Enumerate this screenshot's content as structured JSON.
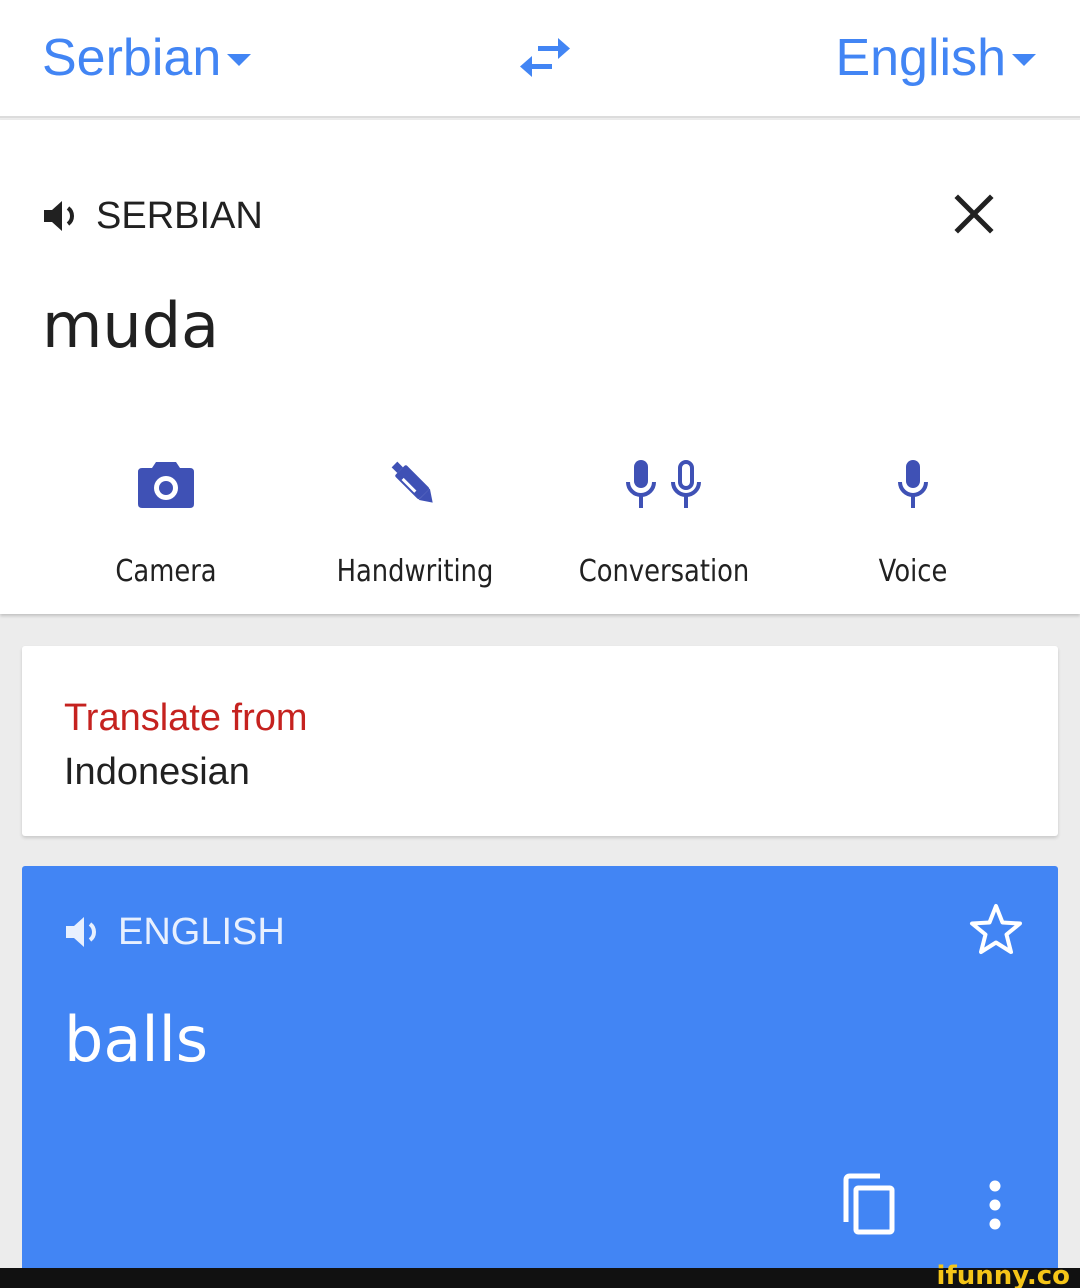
{
  "header": {
    "source_language": "Serbian",
    "target_language": "English",
    "swap_icon": "swap-arrows-icon",
    "accent_color": "#4285f4"
  },
  "input": {
    "language_label": "SERBIAN",
    "text": "muda",
    "tools": [
      {
        "label": "Camera",
        "icon": "camera-icon"
      },
      {
        "label": "Handwriting",
        "icon": "pen-icon"
      },
      {
        "label": "Conversation",
        "icon": "double-mic-icon"
      },
      {
        "label": "Voice",
        "icon": "mic-icon"
      }
    ],
    "tool_icon_color": "#3f51b5"
  },
  "detection": {
    "title": "Translate from",
    "language": "Indonesian",
    "title_color": "#c5221f"
  },
  "result": {
    "language_label": "ENGLISH",
    "text": "balls",
    "background": "#4285f4"
  },
  "watermark": {
    "text": "ifunny.co"
  }
}
